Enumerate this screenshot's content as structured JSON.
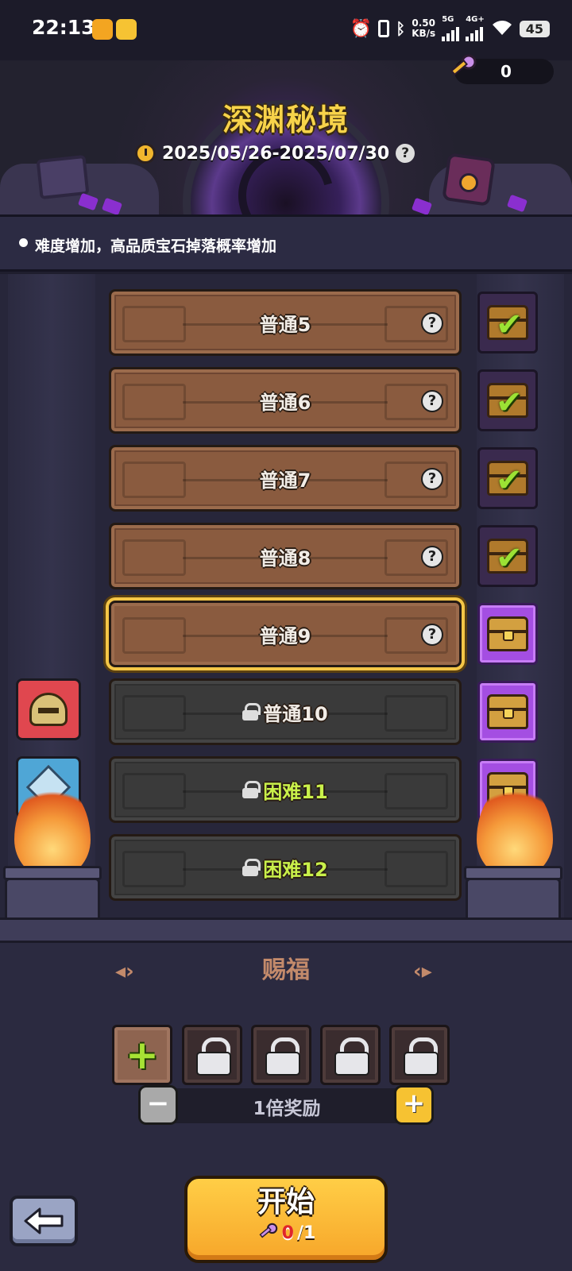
{
  "status_bar": {
    "time": "22:13",
    "net_speed_value": "0.50",
    "net_speed_unit": "KB/s",
    "signal1_label": "5G",
    "signal2_label": "4G+",
    "battery": "45"
  },
  "header": {
    "title": "深渊秘境",
    "date_range": "2025/05/26-2025/07/30",
    "help_glyph": "?",
    "keys_count": "0"
  },
  "notice": {
    "text": "难度增加，高品质宝石掉落概率增加"
  },
  "levels": [
    {
      "label": "普通5",
      "state": "done",
      "has_help": true,
      "chest": "claimed"
    },
    {
      "label": "普通6",
      "state": "done",
      "has_help": true,
      "chest": "claimed"
    },
    {
      "label": "普通7",
      "state": "done",
      "has_help": true,
      "chest": "claimed"
    },
    {
      "label": "普通8",
      "state": "done",
      "has_help": true,
      "chest": "claimed"
    },
    {
      "label": "普通9",
      "state": "current",
      "has_help": true,
      "chest": "available"
    },
    {
      "label": "普通10",
      "state": "locked",
      "has_help": false,
      "chest": "available",
      "reward_icon": "helmet-icon"
    },
    {
      "label": "困难11",
      "state": "locked",
      "has_help": false,
      "chest": "available",
      "reward_icon": "crystal-icon"
    },
    {
      "label": "困难12",
      "state": "locked",
      "has_help": false,
      "chest": "none"
    }
  ],
  "blessing": {
    "title": "赐福",
    "slots": [
      "add",
      "locked",
      "locked",
      "locked",
      "locked"
    ]
  },
  "multiplier": {
    "label": "1倍奖励",
    "minus": "−",
    "plus": "+"
  },
  "start": {
    "label": "开始",
    "have": "0",
    "need": "/1"
  },
  "colors": {
    "accent_gold": "#f7d34a",
    "hard_label": "#c9f04a",
    "bless_title": "#c38a6b"
  }
}
